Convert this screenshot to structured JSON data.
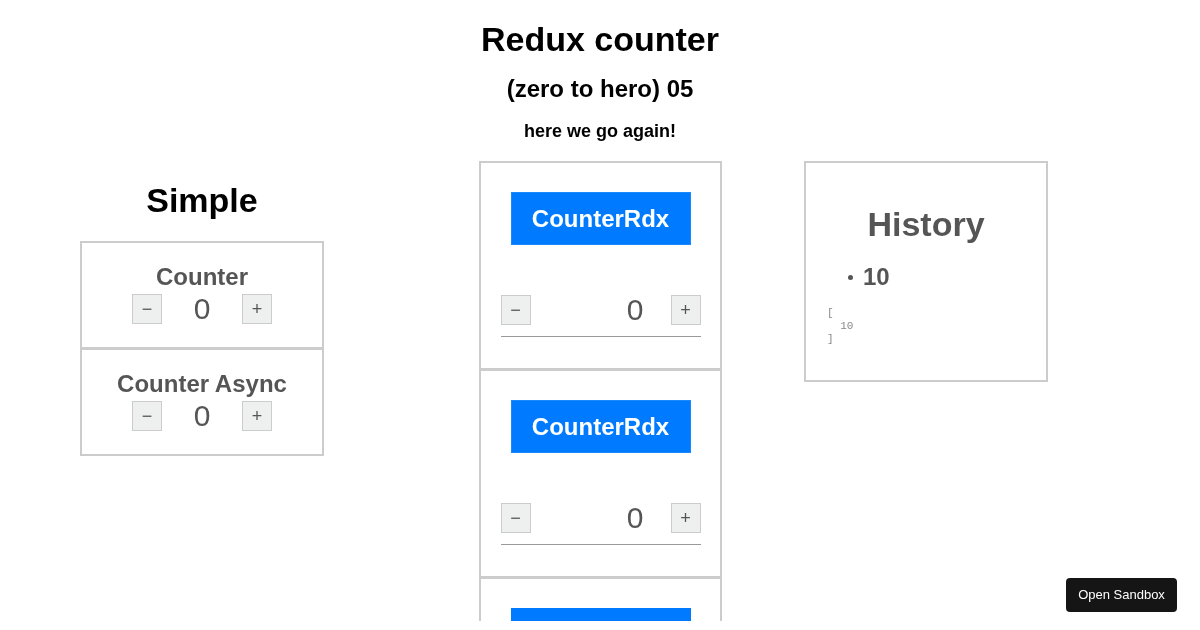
{
  "title": "Redux counter",
  "subtitle": "(zero to hero) 05",
  "tagline": "here we go again!",
  "simple": {
    "heading": "Simple",
    "counters": [
      {
        "label": "Counter",
        "minus": "−",
        "value": "0",
        "plus": "+"
      },
      {
        "label": "Counter Async",
        "minus": "−",
        "value": "0",
        "plus": "+"
      }
    ]
  },
  "redux_counters": [
    {
      "button": "CounterRdx",
      "minus": "−",
      "value": "0",
      "plus": "+"
    },
    {
      "button": "CounterRdx",
      "minus": "−",
      "value": "0",
      "plus": "+"
    }
  ],
  "history": {
    "heading": "History",
    "items": [
      "10"
    ],
    "json_dump": "[\n  10\n]"
  },
  "open_sandbox": "Open Sandbox"
}
